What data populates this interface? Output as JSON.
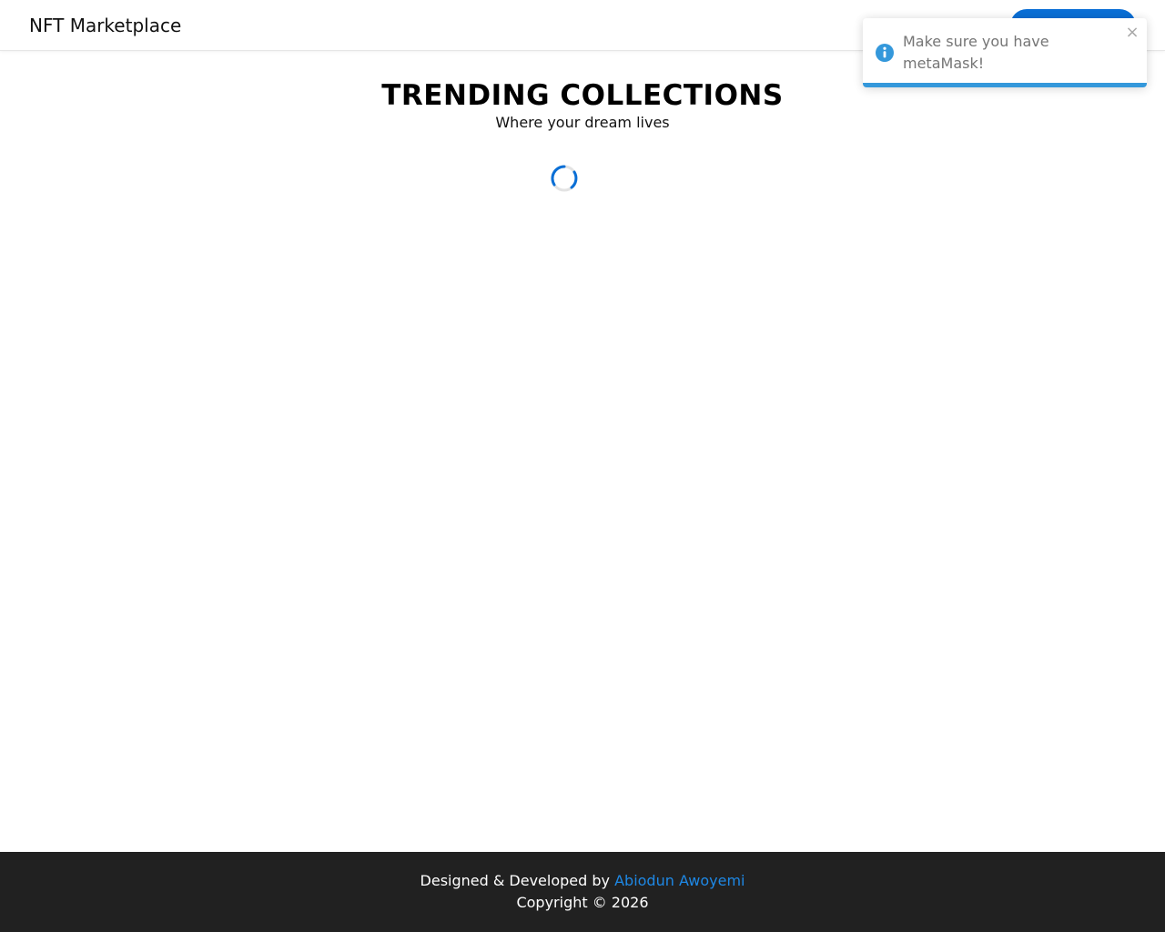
{
  "navbar": {
    "brand": "NFT Marketplace",
    "connect_button_color": "#0a6fd6"
  },
  "hero": {
    "title": "TRENDING COLLECTIONS",
    "subtitle": "Where your dream lives"
  },
  "loader": {
    "icon": "spinner-icon",
    "color": "#0a6fd6"
  },
  "toast": {
    "icon": "info-icon",
    "message": "Make sure you have metaMask!",
    "close_glyph": "×",
    "accent_color": "#3498db",
    "progress": 1.0
  },
  "footer": {
    "credit_prefix": "Designed & Developed by ",
    "author": "Abiodun Awoyemi",
    "copyright": "Copyright © 2026",
    "link_color": "#1e88e5"
  }
}
